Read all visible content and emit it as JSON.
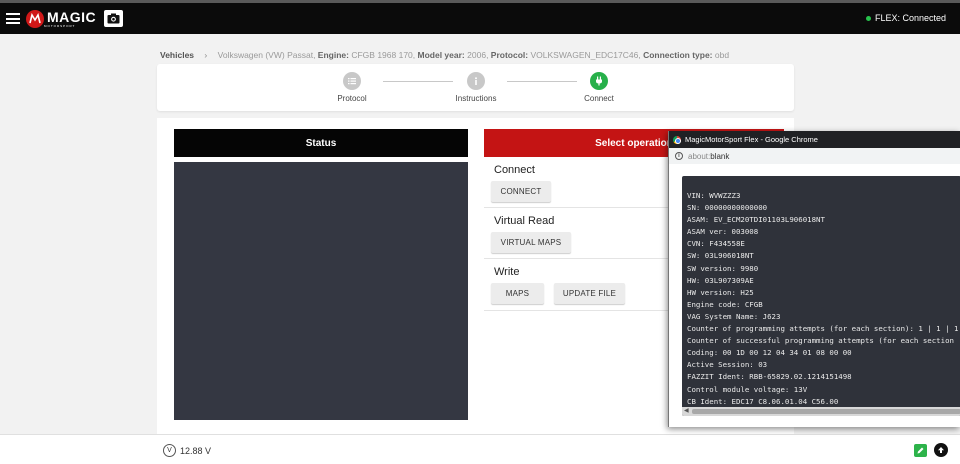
{
  "topbar": {
    "logo_text": "MAGIC",
    "logo_subtext": "MOTORSPORT",
    "flex_status": "FLEX: Connected",
    "flex_status_color": "#27c24c"
  },
  "breadcrumb": {
    "first": "Vehicles",
    "vehicle": "Volkswagen (VW) Passat",
    "engine_label": "Engine:",
    "engine": "CFGB 1968 170",
    "model_year_label": "Model year:",
    "model_year": "2006",
    "protocol_label": "Protocol:",
    "protocol": "VOLKSWAGEN_EDC17C46",
    "connection_label": "Connection type:",
    "connection": "obd"
  },
  "stepper": {
    "steps": [
      {
        "label": "Protocol",
        "state": "done",
        "icon": "list-icon"
      },
      {
        "label": "Instructions",
        "state": "done",
        "icon": "info-icon"
      },
      {
        "label": "Connect",
        "state": "active",
        "icon": "plug-icon"
      }
    ]
  },
  "status_panel": {
    "header": "Status"
  },
  "operations": {
    "header": "Select operation",
    "connect": {
      "title": "Connect",
      "button": "CONNECT"
    },
    "virtual_read": {
      "title": "Virtual Read",
      "button": "VIRTUAL MAPS"
    },
    "write": {
      "title": "Write",
      "buttons": [
        "MAPS",
        "UPDATE FILE"
      ]
    }
  },
  "bottombar": {
    "voltage": "12.88 V",
    "voltage_icon": "V"
  },
  "popup": {
    "window_title": "MagicMotorSport Flex - Google Chrome",
    "address": "about:blank",
    "address_prefix": "about:",
    "address_suffix": "blank",
    "lines": [
      "VIN: WVWZZZ3",
      "SN: 00000000000000",
      "ASAM: EV_ECM20TDI01103L906018NT",
      "ASAM ver: 003008",
      "CVN: F434558E",
      "SW: 03L906018NT",
      "SW version: 9980",
      "HW: 03L907309AE",
      "HW version: H25",
      "Engine code: CFGB",
      "VAG System Name: J623",
      "Counter of programming attempts (for each section): 1 | 1 | 1",
      "Counter of successful programming attempts (for each section",
      "Coding: 00 1D 00 12 04 34 01 08 00 00",
      "Active Session: 03",
      "FAZZIT Ident: RBB-65829.02.1214151498",
      "Control module voltage: 13V",
      "CB Ident: EDC17 C8.06.01.04 C56.00"
    ]
  }
}
